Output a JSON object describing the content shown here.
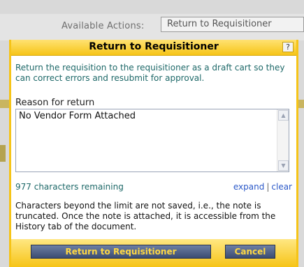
{
  "background": {
    "available_actions_label": "Available Actions:",
    "selected_action": "Return to Requisitioner"
  },
  "modal": {
    "title": "Return to Requisitioner",
    "help_label": "?",
    "description": "Return the requisition to the requisitioner as a draft cart so they can correct errors and resubmit for approval.",
    "reason_label": "Reason for return",
    "reason_value": "No Vendor Form Attached",
    "chars_remaining": "977 characters remaining",
    "expand_link": "expand",
    "link_separator": "|",
    "clear_link": "clear",
    "note": "Characters beyond the limit are not saved, i.e., the note is truncated. Once the note is attached, it is accessible from the History tab of the document.",
    "return_button": "Return to Requisitioner",
    "cancel_button": "Cancel"
  },
  "colors": {
    "modal_border": "#f6c417",
    "button_bg": "#3b4c72",
    "button_text": "#ffd843",
    "teal_text": "#1d6868",
    "link": "#2a58c8"
  },
  "icons": {
    "scroll_up": "up-arrow-icon",
    "scroll_down": "down-arrow-icon"
  }
}
